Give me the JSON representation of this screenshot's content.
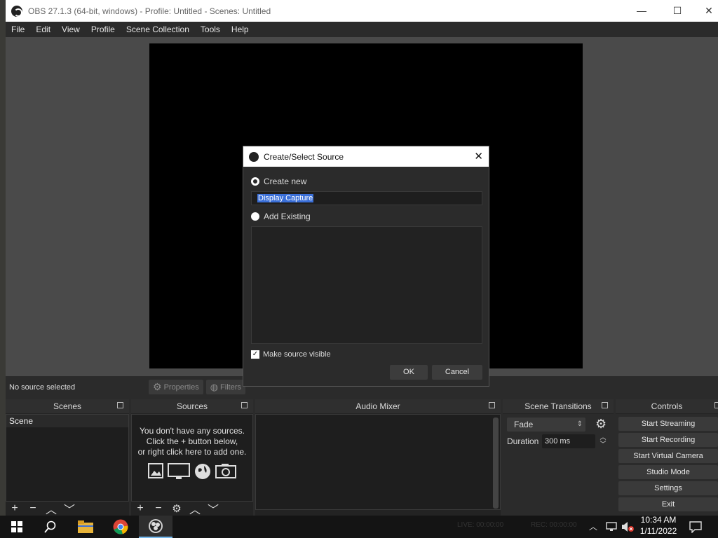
{
  "window": {
    "title": "OBS 27.1.3 (64-bit, windows) - Profile: Untitled - Scenes: Untitled",
    "controls": {
      "minimize": "—",
      "maximize": "☐",
      "close": "✕"
    }
  },
  "menu": [
    "File",
    "Edit",
    "View",
    "Profile",
    "Scene Collection",
    "Tools",
    "Help"
  ],
  "source_toolbar": {
    "status": "No source selected",
    "properties": "Properties",
    "filters": "Filters"
  },
  "docks": {
    "scenes": {
      "title": "Scenes",
      "items": [
        "Scene"
      ]
    },
    "sources": {
      "title": "Sources",
      "empty_line1": "You don't have any sources.",
      "empty_line2": "Click the + button below,",
      "empty_line3": "or right click here to add one."
    },
    "audio_mixer": {
      "title": "Audio Mixer"
    },
    "transitions": {
      "title": "Scene Transitions",
      "transition": "Fade",
      "duration_label": "Duration",
      "duration_value": "300 ms"
    },
    "controls": {
      "title": "Controls",
      "buttons": [
        "Start Streaming",
        "Start Recording",
        "Start Virtual Camera",
        "Studio Mode",
        "Settings",
        "Exit"
      ]
    }
  },
  "status_bar": {
    "live": "LIVE: 00:00:00",
    "rec": "REC: 00:00:00"
  },
  "dialog": {
    "title": "Create/Select Source",
    "create_new_label": "Create new",
    "create_new_selected": true,
    "name_value": "Display Capture",
    "add_existing_label": "Add Existing",
    "make_visible_label": "Make source visible",
    "make_visible_checked": true,
    "ok": "OK",
    "cancel": "Cancel",
    "close": "✕"
  },
  "taskbar": {
    "time": "10:34 AM",
    "date": "1/11/2022"
  },
  "colors": {
    "selection": "#3a6fd8",
    "panel": "#2b2b2b",
    "dock_bg": "#1e1e1e"
  }
}
